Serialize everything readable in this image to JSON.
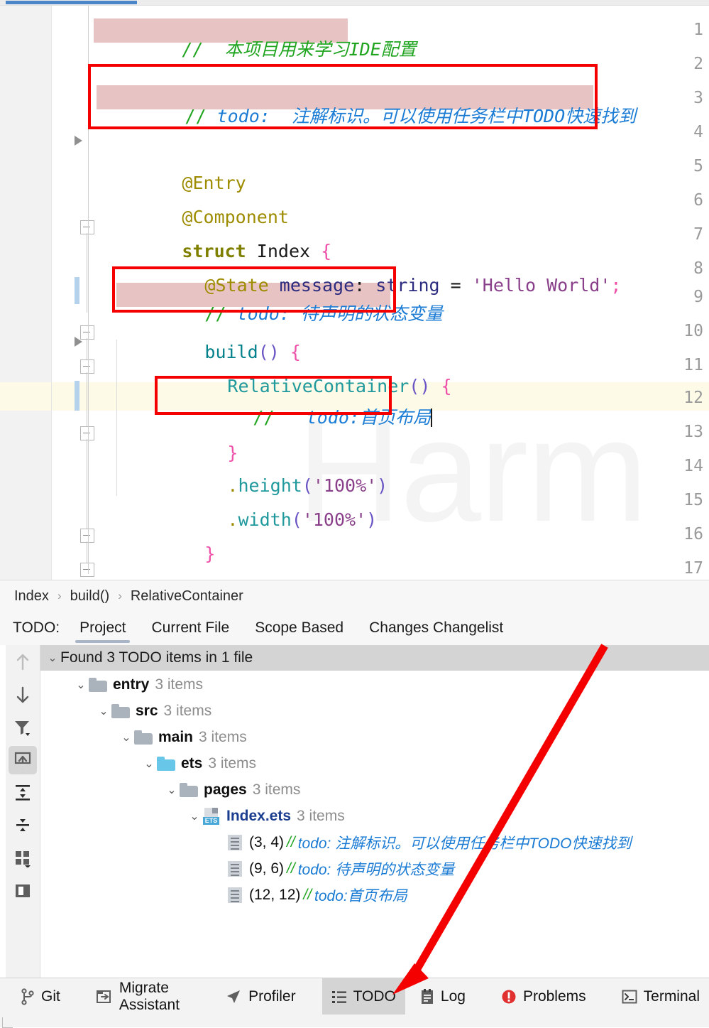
{
  "window": {
    "progress_percent": 19
  },
  "editor": {
    "watermark": "Harm",
    "line_numbers": [
      "1",
      "2",
      "3",
      "4",
      "5",
      "6",
      "7",
      "8",
      "9",
      "10",
      "11",
      "12",
      "13",
      "14",
      "15",
      "16",
      "17"
    ],
    "lines": {
      "l1_comment": "//  本项目用来学习IDE配置",
      "l3_slashes": "// ",
      "l3_todo": "todo:  注解标识。可以使用任务栏中TODO快速找到",
      "l5": "@Entry",
      "l6": "@Component",
      "l7_kw": "struct",
      "l7_name": " Index ",
      "l7_brace": "{",
      "l8_anno": "@State",
      "l8_ident": " message",
      "l8_colon": ": ",
      "l8_type": "string",
      "l8_eq": " = ",
      "l8_str": "'Hello World'",
      "l8_semi": ";",
      "l9_slashes": "// ",
      "l9_todo": "todo: 待声明的状态变量",
      "l10_fn": "build",
      "l10_paren": "()",
      "l10_brace": " {",
      "l11_fn": "RelativeContainer",
      "l11_paren": "()",
      "l11_brace": " {",
      "l12_slashes": "//   ",
      "l12_todo": "todo:首页布局",
      "l13_brace": "}",
      "l14_dot": ".",
      "l14_fn": "height",
      "l14_open": "(",
      "l14_str": "'100%'",
      "l14_close": ")",
      "l15_dot": ".",
      "l15_fn": "width",
      "l15_open": "(",
      "l15_str": "'100%'",
      "l15_close": ")",
      "l16_brace": "}",
      "l17_brace": "}"
    }
  },
  "breadcrumb": {
    "items": [
      "Index",
      "build()",
      "RelativeContainer"
    ],
    "separator": "›"
  },
  "todo_tool_window": {
    "label": "TODO:",
    "tabs": [
      {
        "label": "Project",
        "active": true
      },
      {
        "label": "Current File",
        "active": false
      },
      {
        "label": "Scope Based",
        "active": false
      },
      {
        "label": "Changes Changelist",
        "active": false
      }
    ],
    "summary": "Found 3 TODO items in 1 file",
    "toolbar_icons": [
      {
        "name": "previous-occurrence-icon",
        "enabled": false
      },
      {
        "name": "next-occurrence-icon",
        "enabled": true
      },
      {
        "name": "filter-icon",
        "enabled": true
      },
      {
        "name": "autoscroll-to-source-icon",
        "enabled": true,
        "selected": true
      },
      {
        "name": "expand-all-icon",
        "enabled": true
      },
      {
        "name": "collapse-all-icon",
        "enabled": true
      },
      {
        "name": "group-by-icon",
        "enabled": true
      },
      {
        "name": "preview-icon",
        "enabled": true
      }
    ],
    "tree": [
      {
        "depth": 0,
        "icon": "folder-icon",
        "name": "entry",
        "count": "3 items",
        "expanded": true,
        "folder_color": "gray"
      },
      {
        "depth": 1,
        "icon": "folder-icon",
        "name": "src",
        "count": "3 items",
        "expanded": true,
        "folder_color": "gray"
      },
      {
        "depth": 2,
        "icon": "folder-icon",
        "name": "main",
        "count": "3 items",
        "expanded": true,
        "folder_color": "gray"
      },
      {
        "depth": 3,
        "icon": "folder-icon",
        "name": "ets",
        "count": "3 items",
        "expanded": true,
        "folder_color": "blue"
      },
      {
        "depth": 4,
        "icon": "folder-icon",
        "name": "pages",
        "count": "3 items",
        "expanded": true,
        "folder_color": "gray"
      },
      {
        "depth": 5,
        "icon": "ets-file-icon",
        "name": "Index.ets",
        "count": "3 items",
        "expanded": true,
        "folder_color": "none"
      }
    ],
    "todo_items": [
      {
        "position": "(3, 4)",
        "slashes": "//",
        "text": "todo: 注解标识。可以使用任务栏中TODO快速找到"
      },
      {
        "position": "(9, 6)",
        "slashes": "//",
        "text": "todo: 待声明的状态变量"
      },
      {
        "position": "(12, 12)",
        "slashes": "//",
        "text": "todo:首页布局"
      }
    ]
  },
  "bottom_toolbar": {
    "buttons": [
      {
        "label": "Git",
        "icon": "git-branch-icon",
        "active": false
      },
      {
        "label": "Migrate Assistant",
        "icon": "migrate-icon",
        "active": false
      },
      {
        "label": "Profiler",
        "icon": "profiler-icon",
        "active": false
      },
      {
        "label": "TODO",
        "icon": "todo-list-icon",
        "active": true
      },
      {
        "label": "Log",
        "icon": "log-icon",
        "active": false
      },
      {
        "label": "Problems",
        "icon": "problems-icon",
        "active": false
      },
      {
        "label": "Terminal",
        "icon": "terminal-icon",
        "active": false
      }
    ]
  },
  "annotations": {
    "highlight_color": "#f50000",
    "boxes": [
      {
        "name": "todo-line-3-highlight"
      },
      {
        "name": "todo-line-9-highlight"
      },
      {
        "name": "todo-line-12-highlight"
      }
    ],
    "arrow": {
      "name": "pointer-arrow",
      "from": "todo-panel-top-right",
      "to": "todo-taskbar-button"
    }
  }
}
